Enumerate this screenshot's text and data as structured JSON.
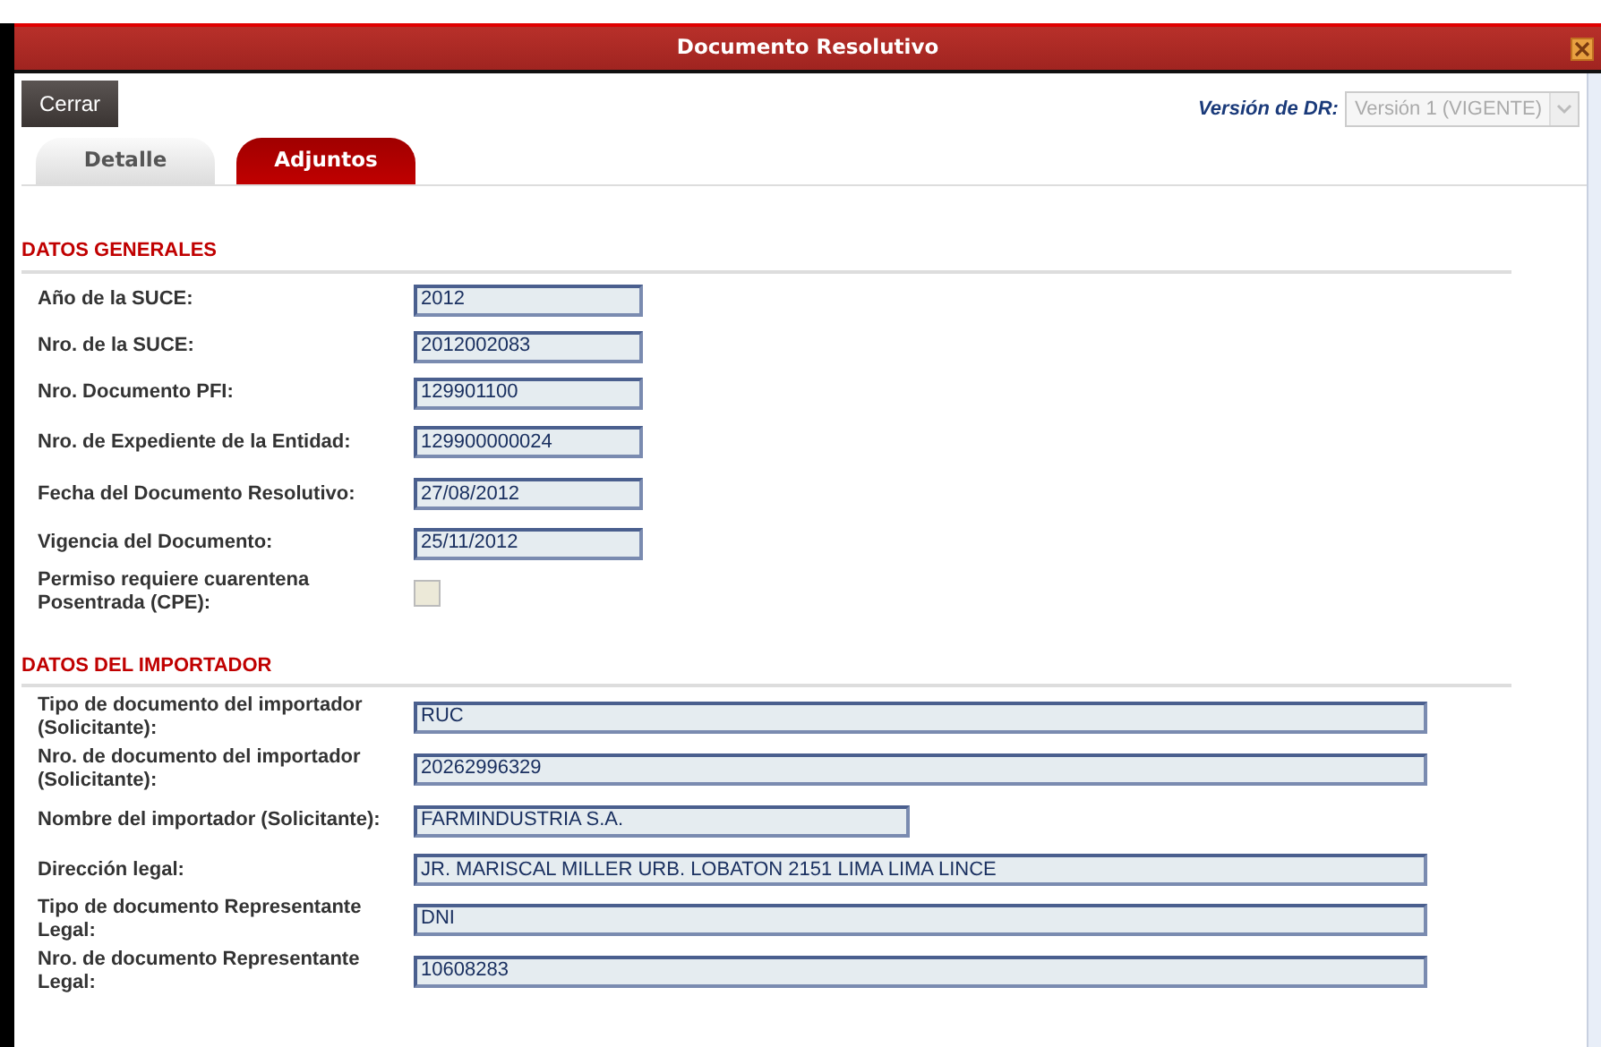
{
  "window": {
    "title": "Documento Resolutivo"
  },
  "toolbar": {
    "close_button": "Cerrar",
    "version_label": "Versión de DR:",
    "version_select": {
      "value": "Versión 1 (VIGENTE)",
      "disabled": true
    }
  },
  "tabs": [
    {
      "label": "Detalle",
      "selected": false
    },
    {
      "label": "Adjuntos",
      "selected": true
    }
  ],
  "sections": [
    {
      "title": "DATOS GENERALES",
      "fields": [
        {
          "label": "Año de la SUCE:",
          "value": "2012",
          "kind": "short"
        },
        {
          "label": "Nro. de la SUCE:",
          "value": "2012002083",
          "kind": "short"
        },
        {
          "label": "Nro. Documento PFI:",
          "value": "129901100",
          "kind": "short"
        },
        {
          "label": "Nro. de Expediente de la Entidad:",
          "value": "129900000024",
          "kind": "short"
        },
        {
          "label": "Fecha del Documento Resolutivo:",
          "value": "27/08/2012",
          "kind": "short"
        },
        {
          "label": "Vigencia del Documento:",
          "value": "25/11/2012",
          "kind": "short"
        },
        {
          "label": "Permiso requiere cuarentena Posentrada (CPE):",
          "kind": "checkbox",
          "checked": false
        }
      ]
    },
    {
      "title": "DATOS DEL IMPORTADOR",
      "fields": [
        {
          "label": "Tipo de documento del importador (Solicitante):",
          "value": "RUC",
          "kind": "long"
        },
        {
          "label": "Nro. de documento del importador (Solicitante):",
          "value": "20262996329",
          "kind": "long"
        },
        {
          "label": "Nombre del importador (Solicitante):",
          "value": "FARMINDUSTRIA S.A.",
          "kind": "medium"
        },
        {
          "label": "Dirección legal:",
          "value": "JR. MARISCAL MILLER URB. LOBATON 2151 LIMA LIMA LINCE",
          "kind": "long"
        },
        {
          "label": "Tipo de documento Representante Legal:",
          "value": "DNI",
          "kind": "long"
        },
        {
          "label": "Nro. de documento Representante Legal:",
          "value": "10608283",
          "kind": "long"
        }
      ]
    }
  ]
}
